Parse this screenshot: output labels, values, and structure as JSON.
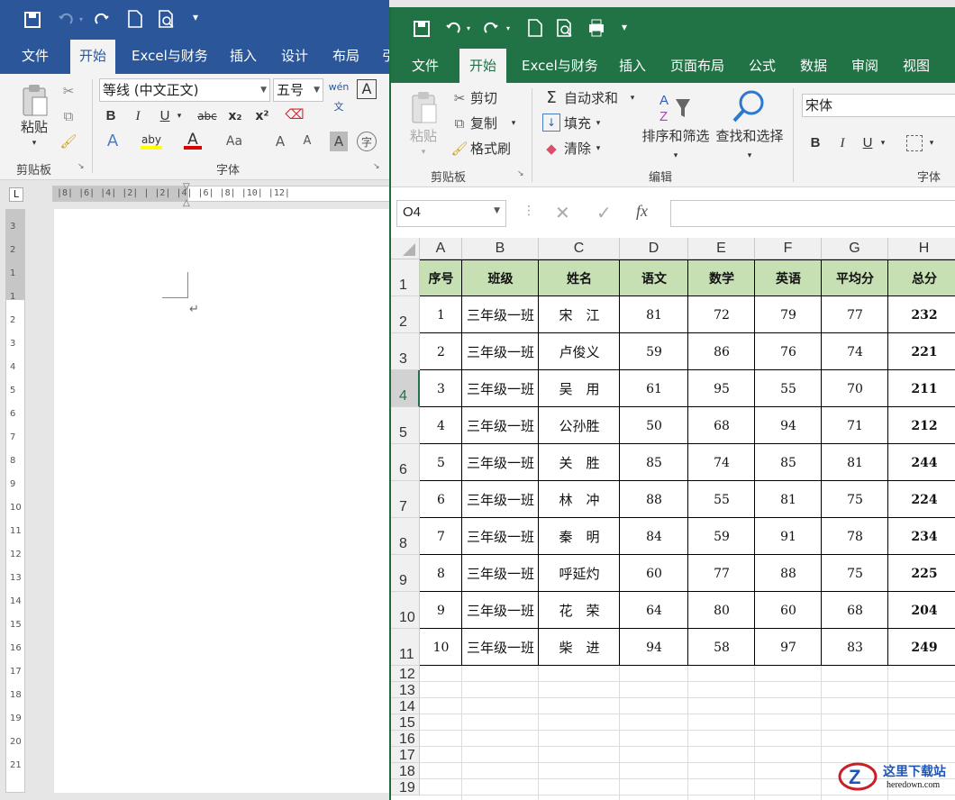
{
  "word": {
    "tabs": [
      "文件",
      "开始",
      "Excel与财务",
      "插入",
      "设计",
      "布局",
      "引"
    ],
    "clipboard_label": "剪贴板",
    "paste_label": "粘贴",
    "font_name": "等线 (中文正文)",
    "font_size": "五号",
    "font_group_label": "字体",
    "format_buttons": [
      "B",
      "I",
      "U",
      "abc",
      "x₂",
      "x²"
    ],
    "ruler_text": "|8| |6| |4| |2| | |2| |4| |6| |8| |10| |12|",
    "vruler_text": "3 2 1 1 2 3 4 5 6 7 8 9 10 11 12 13 14 15 16 17 18 19 20 21",
    "return_mark": "↵",
    "ruler_corner": "L"
  },
  "excel": {
    "tabs": [
      "文件",
      "开始",
      "Excel与财务",
      "插入",
      "页面布局",
      "公式",
      "数据",
      "审阅",
      "视图"
    ],
    "ribbon": {
      "paste": "粘贴",
      "cut": "剪切",
      "copy": "复制",
      "format_painter": "格式刷",
      "clipboard_label": "剪贴板",
      "autosum": "自动求和",
      "fill": "填充",
      "clear": "清除",
      "sort_filter": "排序和筛选",
      "find_select": "查找和选择",
      "edit_label": "编辑",
      "font_name": "宋体",
      "font_label": "字体"
    },
    "name_box": "O4",
    "fx": "fx",
    "columns": [
      "A",
      "B",
      "C",
      "D",
      "E",
      "F",
      "G",
      "H"
    ],
    "rows": [
      "1",
      "2",
      "3",
      "4",
      "5",
      "6",
      "7",
      "8",
      "9",
      "10",
      "11",
      "12",
      "13",
      "14",
      "15",
      "16",
      "17",
      "18",
      "19"
    ],
    "table": {
      "headers": [
        "序号",
        "班级",
        "姓名",
        "语文",
        "数学",
        "英语",
        "平均分",
        "总分"
      ],
      "rows": [
        [
          "1",
          "三年级一班",
          "宋　江",
          "81",
          "72",
          "79",
          "77",
          "232"
        ],
        [
          "2",
          "三年级一班",
          "卢俊义",
          "59",
          "86",
          "76",
          "74",
          "221"
        ],
        [
          "3",
          "三年级一班",
          "吴　用",
          "61",
          "95",
          "55",
          "70",
          "211"
        ],
        [
          "4",
          "三年级一班",
          "公孙胜",
          "50",
          "68",
          "94",
          "71",
          "212"
        ],
        [
          "5",
          "三年级一班",
          "关　胜",
          "85",
          "74",
          "85",
          "81",
          "244"
        ],
        [
          "6",
          "三年级一班",
          "林　冲",
          "88",
          "55",
          "81",
          "75",
          "224"
        ],
        [
          "7",
          "三年级一班",
          "秦　明",
          "84",
          "59",
          "91",
          "78",
          "234"
        ],
        [
          "8",
          "三年级一班",
          "呼延灼",
          "60",
          "77",
          "88",
          "75",
          "225"
        ],
        [
          "9",
          "三年级一班",
          "花　荣",
          "64",
          "80",
          "60",
          "68",
          "204"
        ],
        [
          "10",
          "三年级一班",
          "柴　进",
          "94",
          "58",
          "97",
          "83",
          "249"
        ]
      ]
    }
  },
  "watermark": {
    "text": "这里下载站",
    "url": "heredown.com"
  },
  "colors": {
    "word_blue": "#2b579a",
    "excel_green": "#217346",
    "header_fill": "#c6e0b4"
  }
}
